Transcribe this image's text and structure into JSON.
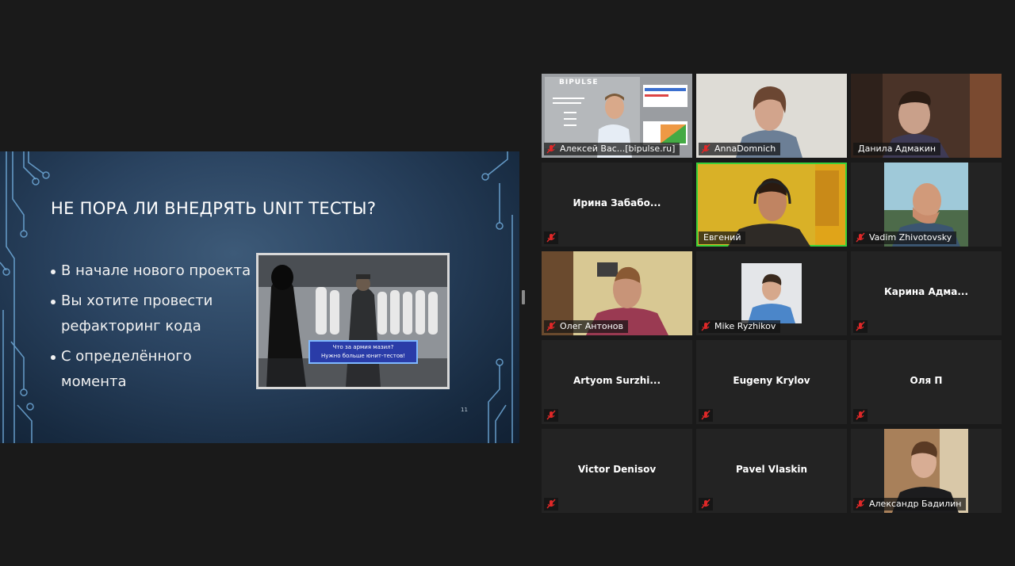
{
  "slide": {
    "title": "НЕ ПОРА ЛИ ВНЕДРЯТЬ UNIT ТЕСТЫ?",
    "bullets": [
      "В начале нового проекта",
      "Вы хотите провести рефакторинг кода",
      "С определённого момента"
    ],
    "caption_line1": "Что за армия мазил?",
    "caption_line2": "Нужно больше юнит-тестов!",
    "page_number": "11"
  },
  "thumbnail": {
    "brand": "BIPULSE"
  },
  "participants": [
    {
      "name": "Алексей Вас...[bipulse.ru]",
      "video": true,
      "muted": true
    },
    {
      "name": "AnnaDomnich",
      "video": true,
      "muted": true
    },
    {
      "name": "Данила Адмакин",
      "video": true,
      "muted": false
    },
    {
      "name": "Ирина Забабо...",
      "video": false,
      "muted": true
    },
    {
      "name": "Евгений",
      "video": true,
      "muted": false,
      "active": true
    },
    {
      "name": "Vadim Zhivotovsky",
      "video": true,
      "muted": true
    },
    {
      "name": "Олег Антонов",
      "video": true,
      "muted": true
    },
    {
      "name": "Mike Ryzhikov",
      "video": true,
      "muted": true
    },
    {
      "name": "Карина Адма...",
      "video": false,
      "muted": true
    },
    {
      "name": "Artyom Surzhi...",
      "video": false,
      "muted": true
    },
    {
      "name": "Eugeny Krylov",
      "video": false,
      "muted": true
    },
    {
      "name": "Оля П",
      "video": false,
      "muted": true
    },
    {
      "name": "Victor Denisov",
      "video": false,
      "muted": true
    },
    {
      "name": "Pavel Vlaskin",
      "video": false,
      "muted": true
    },
    {
      "name": "Александр Бадилин",
      "video": true,
      "muted": true
    }
  ],
  "colors": {
    "background": "#1a1a1a",
    "tile": "#232323",
    "active_border": "#3ad13a",
    "mute_icon": "#e02828",
    "caption_bg": "#2a3ca8"
  }
}
